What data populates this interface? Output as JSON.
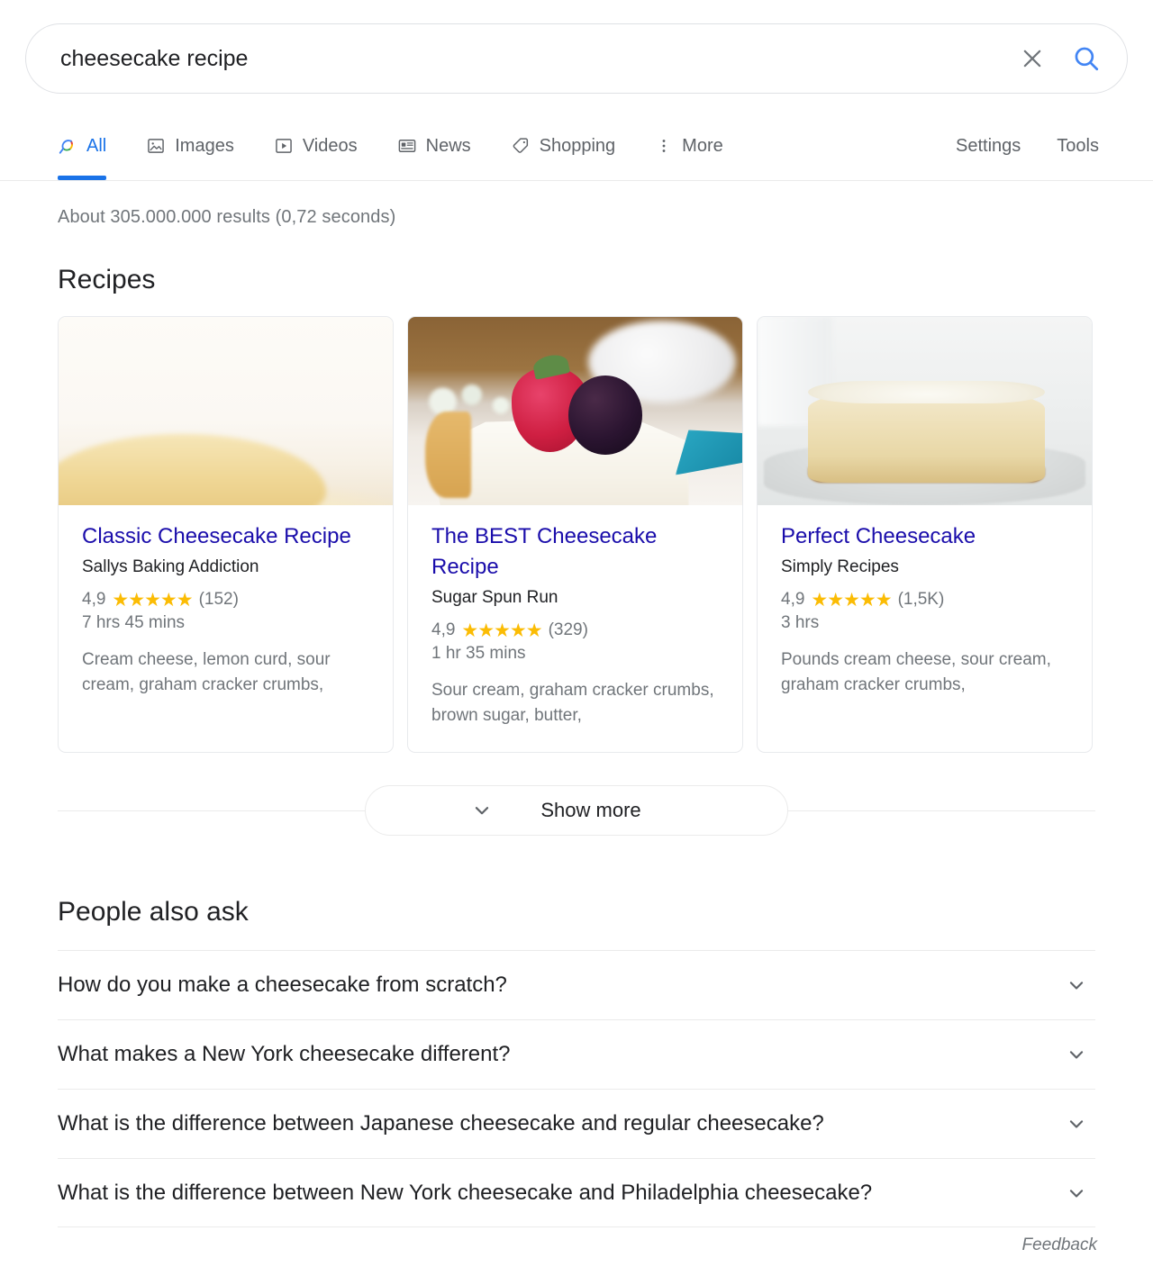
{
  "search": {
    "query": "cheesecake recipe",
    "placeholder": "Search",
    "clear_icon": "close-icon",
    "search_icon": "search-icon"
  },
  "nav": {
    "tabs": [
      {
        "label": "All",
        "icon": "search-icon",
        "active": true
      },
      {
        "label": "Images",
        "icon": "image-icon",
        "active": false
      },
      {
        "label": "Videos",
        "icon": "video-icon",
        "active": false
      },
      {
        "label": "News",
        "icon": "news-icon",
        "active": false
      },
      {
        "label": "Shopping",
        "icon": "tag-icon",
        "active": false
      },
      {
        "label": "More",
        "icon": "more-vertical-icon",
        "active": false
      }
    ],
    "right_items": [
      {
        "label": "Settings"
      },
      {
        "label": "Tools"
      }
    ]
  },
  "result_stats": "About 305.000.000 results (0,72 seconds)",
  "recipes": {
    "heading": "Recipes",
    "cards": [
      {
        "title": "Classic Cheesecake Recipe",
        "source": "Sallys Baking Addiction",
        "rating": "4,9",
        "stars": "★★★★★",
        "rating_count": "(152)",
        "time": "7 hrs 45 mins",
        "ingredients": "Cream cheese, lemon curd, sour cream, graham cracker crumbs,",
        "image_alt": "classic-cheesecake-photo"
      },
      {
        "title": "The BEST Cheesecake Recipe",
        "source": "Sugar Spun Run",
        "rating": "4,9",
        "stars": "★★★★★",
        "rating_count": "(329)",
        "time": "1 hr 35 mins",
        "ingredients": "Sour cream, graham cracker crumbs, brown sugar, butter,",
        "image_alt": "best-cheesecake-slice-with-berries-photo"
      },
      {
        "title": "Perfect Cheesecake",
        "source": "Simply Recipes",
        "rating": "4,9",
        "stars": "★★★★★",
        "rating_count": "(1,5K)",
        "time": "3 hrs",
        "ingredients": "Pounds cream cheese, sour cream, graham cracker crumbs,",
        "image_alt": "perfect-cheesecake-whole-photo"
      }
    ],
    "show_more_label": "Show more",
    "show_more_icon": "chevron-down-icon"
  },
  "people_also_ask": {
    "heading": "People also ask",
    "questions": [
      "How do you make a cheesecake from scratch?",
      "What makes a New York cheesecake different?",
      "What is the difference between Japanese cheesecake and regular cheesecake?",
      "What is the difference between New York cheesecake and Philadelphia cheesecake?"
    ],
    "expand_icon": "chevron-down-icon"
  },
  "feedback": {
    "label": "Feedback"
  },
  "colors": {
    "link_blue": "#1a0dab",
    "accent_blue": "#1a73e8",
    "star_yellow": "#fbbc04",
    "text_primary": "#202124",
    "text_secondary": "#70757a",
    "border": "#ebebeb"
  }
}
